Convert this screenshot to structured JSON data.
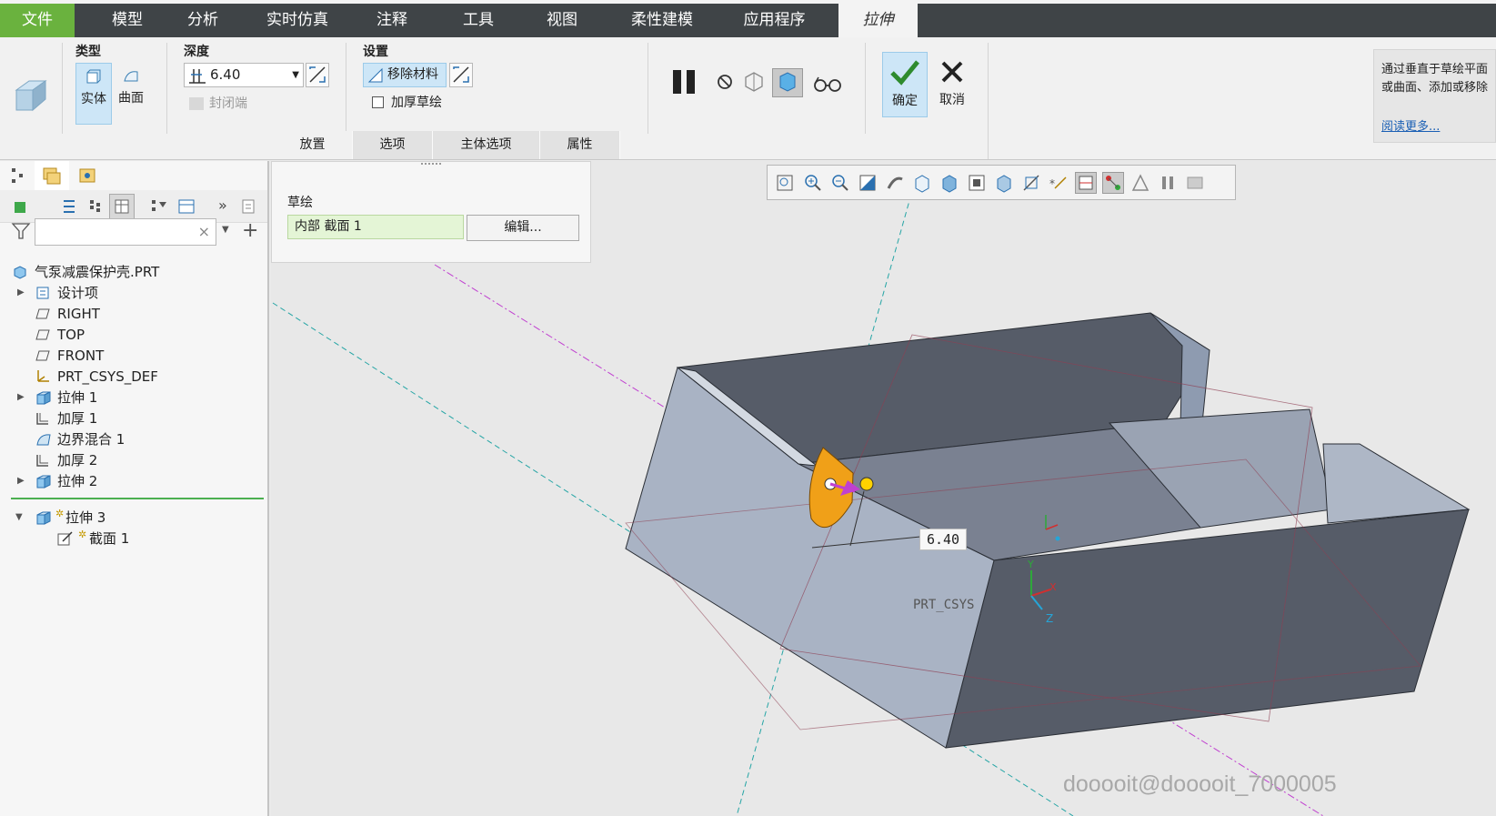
{
  "menu": {
    "file": "文件",
    "model": "模型",
    "analysis": "分析",
    "realtime_sim": "实时仿真",
    "annotate": "注释",
    "tools": "工具",
    "view": "视图",
    "flexible_modeling": "柔性建模",
    "applications": "应用程序",
    "extrude": "拉伸"
  },
  "ribbon": {
    "type_label": "类型",
    "solid": "实体",
    "surface": "曲面",
    "depth_label": "深度",
    "depth_value": "6.40",
    "capped_ends": "封闭端",
    "settings_label": "设置",
    "remove_material": "移除材料",
    "thicken_sketch": "加厚草绘",
    "ok": "确定",
    "cancel": "取消",
    "help_line1": "通过垂直于草绘平面",
    "help_line2": "或曲面、添加或移除",
    "read_more": "阅读更多...",
    "tabs": [
      "放置",
      "选项",
      "主体选项",
      "属性"
    ]
  },
  "placement": {
    "sketch_label": "草绘",
    "sketch_value": "内部 截面 1",
    "edit_button": "编辑..."
  },
  "tree": {
    "root": "气泵减震保护壳.PRT",
    "items": [
      "设计项",
      "RIGHT",
      "TOP",
      "FRONT",
      "PRT_CSYS_DEF",
      "拉伸 1",
      "加厚 1",
      "边界混合 1",
      "加厚 2",
      "拉伸 2"
    ],
    "new_feature": "拉伸 3",
    "new_section": "截面 1"
  },
  "viewport": {
    "dimension": "6.40",
    "csys_label": "PRT_CSYS",
    "axis_x": "X",
    "axis_y": "Y",
    "axis_z": "Z"
  },
  "watermark": "dooooit@dooooit_7000005",
  "colors": {
    "menubar": "#3f4447",
    "file_tab": "#6ab23e",
    "ribbon": "#f1f1f1",
    "selected": "#cde6f7",
    "model_light": "#a9b3c4",
    "model_dark": "#565c68",
    "preview": "#f0a018",
    "datum_plane": "#8e3f52",
    "datum_axis": "#25a5a5",
    "pink_axis": "#c040d0"
  }
}
